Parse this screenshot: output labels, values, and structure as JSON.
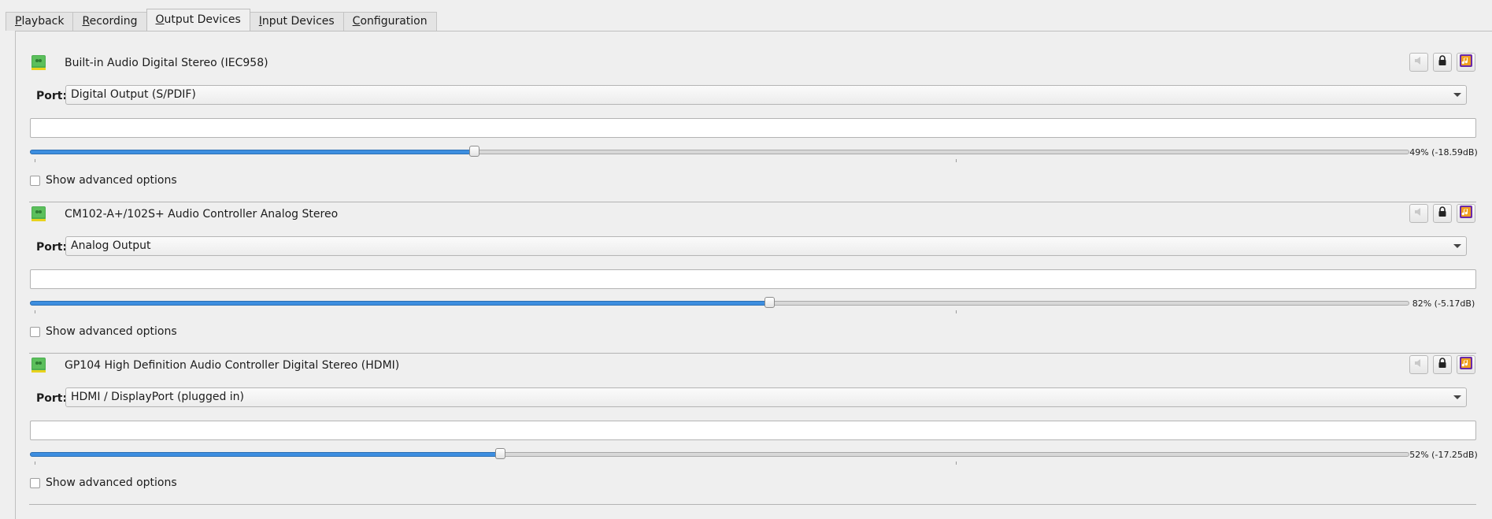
{
  "tabs": [
    {
      "mnemonic": "P",
      "rest": "layback",
      "active": false
    },
    {
      "mnemonic": "R",
      "rest": "ecording",
      "active": false
    },
    {
      "mnemonic": "O",
      "rest": "utput Devices",
      "active": true
    },
    {
      "mnemonic": "I",
      "rest": "nput Devices",
      "active": false
    },
    {
      "mnemonic": "C",
      "rest": "onfiguration",
      "active": false
    }
  ],
  "port_label": "Port:",
  "advanced_label": "Show advanced options",
  "accent_color": "#3d8ee0",
  "devices": [
    {
      "name": "Built-in Audio Digital Stereo (IEC958)",
      "port": "Digital Output (S/PDIF)",
      "volume_fraction": 0.322,
      "level_text": "49% (-18.59dB)",
      "icons": [
        "speaker-device-icon",
        "mute-icon",
        "lock-icon",
        "default-device-icon"
      ]
    },
    {
      "name": "CM102-A+/102S+ Audio Controller Analog Stereo",
      "port": "Analog Output",
      "volume_fraction": 0.536,
      "level_text": "82% (-5.17dB)",
      "icons": [
        "speaker-device-icon",
        "mute-icon",
        "lock-icon",
        "default-device-icon"
      ]
    },
    {
      "name": "GP104 High Definition Audio Controller Digital Stereo (HDMI)",
      "port": "HDMI / DisplayPort (plugged in)",
      "volume_fraction": 0.341,
      "level_text": "52% (-17.25dB)",
      "icons": [
        "speaker-device-icon",
        "mute-icon",
        "lock-icon",
        "default-device-icon"
      ]
    }
  ]
}
